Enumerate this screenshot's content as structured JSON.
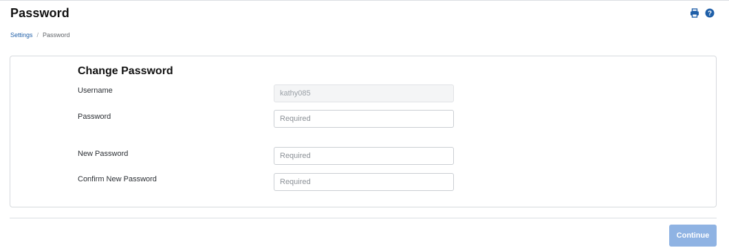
{
  "page": {
    "title": "Password"
  },
  "header": {
    "icons": [
      "printer-icon",
      "help-icon"
    ]
  },
  "breadcrumb": {
    "items": [
      {
        "label": "Settings"
      },
      {
        "label": "Password"
      }
    ],
    "separator": "/"
  },
  "form": {
    "title": "Change Password",
    "fields": [
      {
        "label": "Username",
        "value": "kathy085",
        "placeholder": "",
        "readonly": true
      },
      {
        "label": "Password",
        "value": "",
        "placeholder": "Required",
        "readonly": false
      },
      {
        "label": "New Password",
        "value": "",
        "placeholder": "Required",
        "readonly": false
      },
      {
        "label": "Confirm New Password",
        "value": "",
        "placeholder": "Required",
        "readonly": false
      }
    ]
  },
  "actions": {
    "continue_label": "Continue"
  },
  "colors": {
    "accent": "#1f5fa8",
    "button_disabled": "#8fb3e3"
  }
}
